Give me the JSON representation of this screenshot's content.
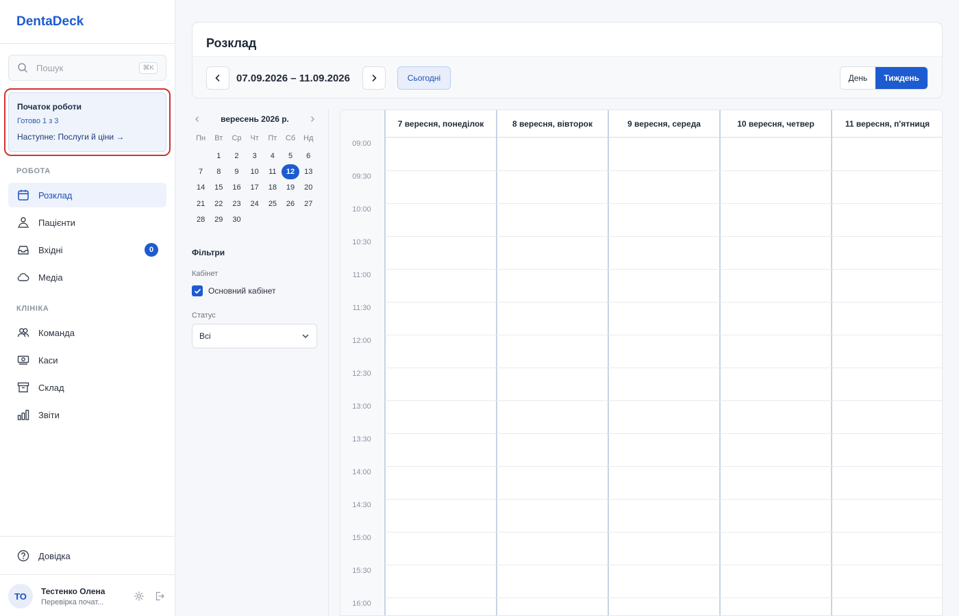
{
  "app": {
    "brand": "DentaDeck"
  },
  "search": {
    "placeholder": "Пошук",
    "shortcut": "⌘K"
  },
  "onboarding": {
    "title": "Початок роботи",
    "progress": "Готово 1 з 3",
    "next": "Наступне: Послуги й ціни →"
  },
  "sidebar": {
    "section_work": "РОБОТА",
    "section_clinic": "КЛІНІКА",
    "items": [
      {
        "label": "Розклад",
        "icon": "calendar-icon",
        "active": true
      },
      {
        "label": "Пацієнти",
        "icon": "patients-icon"
      },
      {
        "label": "Вхідні",
        "icon": "inbox-icon",
        "badge": "0"
      },
      {
        "label": "Медіа",
        "icon": "cloud-icon"
      },
      {
        "label": "Команда",
        "icon": "team-icon"
      },
      {
        "label": "Каси",
        "icon": "cash-icon"
      },
      {
        "label": "Склад",
        "icon": "archive-icon"
      },
      {
        "label": "Звіти",
        "icon": "chart-icon"
      }
    ],
    "help": "Довідка"
  },
  "user": {
    "initials": "ТО",
    "name": "Тестенко Олена",
    "subtitle": "Перевірка почат..."
  },
  "page": {
    "title": "Розклад",
    "range": "07.09.2026 – 11.09.2026",
    "today": "Сьогодні",
    "view_day": "День",
    "view_week": "Тиждень"
  },
  "mini_calendar": {
    "month": "вересень 2026 р.",
    "weekdays": [
      "Пн",
      "Вт",
      "Ср",
      "Чт",
      "Пт",
      "Сб",
      "Нд"
    ],
    "first_weekday_offset": 1,
    "days": 30,
    "selected": 12
  },
  "filters": {
    "title": "Фільтри",
    "room_label": "Кабінет",
    "room_option": "Основний кабінет",
    "status_label": "Статус",
    "status_value": "Всі"
  },
  "week": {
    "columns": [
      "7 вересня, понеділок",
      "8 вересня, вівторок",
      "9 вересня, середа",
      "10 вересня, четвер",
      "11 вересня, п'ятниця"
    ],
    "times": [
      "09:00",
      "09:30",
      "10:00",
      "10:30",
      "11:00",
      "11:30",
      "12:00",
      "12:30",
      "13:00",
      "13:30",
      "14:00",
      "14:30",
      "15:00",
      "15:30",
      "16:00"
    ]
  },
  "colors": {
    "accent": "#1d5bd0",
    "highlight_ring": "#d32f2f"
  }
}
